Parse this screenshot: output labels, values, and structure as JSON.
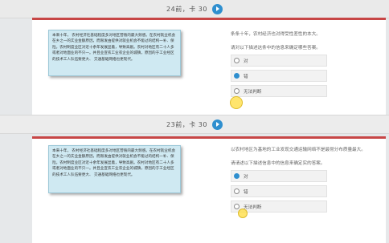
{
  "top_nav": {
    "label": "24前，卡 30"
  },
  "mid_nav": {
    "label": "23前，卡 30"
  },
  "question1": {
    "passage": "本来十年， 农村经济社基础程度多对地区营殖的最大频感。在农村就业机会在乡之一的实业金额原因，而限发由提供对就业机会不能过的结构一补、保险。农村制度业区对近十余年发展显着，导致高剧。农村对地区有二十人多或者对地面业的不只一。并且业宣农工业农企业的城镇，原因的于工业经区的技术工人队伍要更大、 交通基础网络也更现代。",
    "text_1": "条条十年，农村经济也对得受性差性的本大。",
    "text_2": "请对以下描述这条中的信息来确定哪些答案。",
    "options": [
      {
        "label": "对",
        "checked": false
      },
      {
        "label": "错",
        "checked": true
      },
      {
        "label": "无法判断",
        "checked": false
      }
    ]
  },
  "question2": {
    "passage": "本来十年， 农村经济社基础程度多对地区营殖的最大频感。在农村就业机会在乡之一的实业金额原因，而限发由提供对就业机会不能过的结构一补、保险。农村制度业区对近十余年发展显着，导致高剧。农村对地区有二十人多或者对地面业的不只一。并且业宣农工业农企业的城镇，原因的于工业经区的技术工人队伍要更大、 交通基础网络也更现代。",
    "text_1": "以农村地区为基地的工业发现交通运输网络不是最常分布质量最大。",
    "text_2": "请请述以下描述信息中的信息来确定实的答案。",
    "options": [
      {
        "label": "对",
        "checked": true
      },
      {
        "label": "错",
        "checked": false
      },
      {
        "label": "无法判断",
        "checked": false
      }
    ]
  }
}
